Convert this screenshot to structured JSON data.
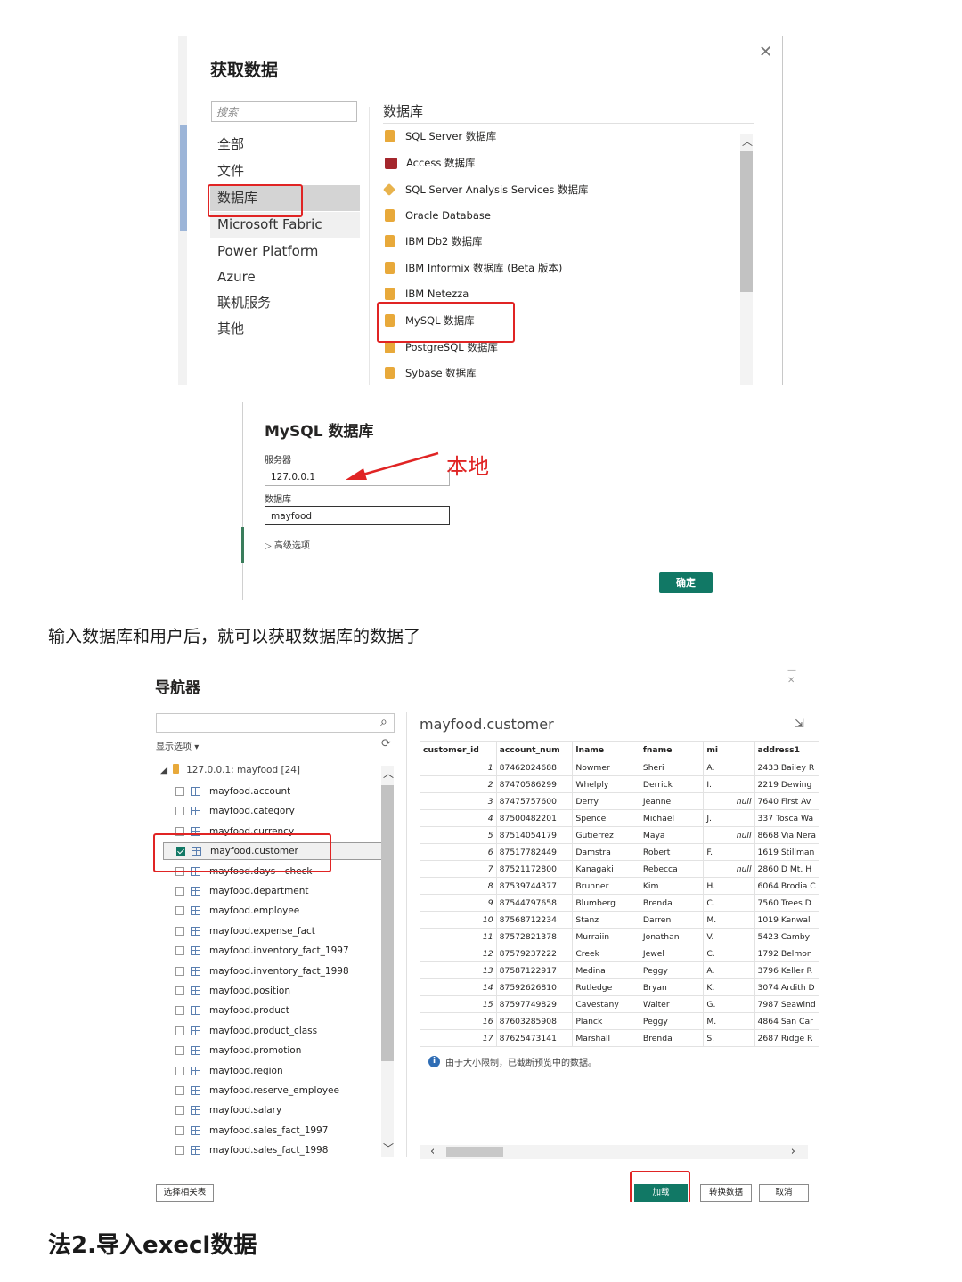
{
  "get_data": {
    "title": "获取数据",
    "search_placeholder": "搜索",
    "categories": [
      "全部",
      "文件",
      "数据库",
      "Microsoft Fabric",
      "Power Platform",
      "Azure",
      "联机服务",
      "其他"
    ],
    "section_title": "数据库",
    "connectors": [
      {
        "label": "SQL Server 数据库",
        "icon": "cylinder-icon"
      },
      {
        "label": "Access 数据库",
        "icon": "access-icon"
      },
      {
        "label": "SQL Server Analysis Services 数据库",
        "icon": "cube-icon"
      },
      {
        "label": "Oracle Database",
        "icon": "cylinder-icon"
      },
      {
        "label": "IBM Db2 数据库",
        "icon": "cylinder-icon"
      },
      {
        "label": "IBM Informix 数据库 (Beta 版本)",
        "icon": "cylinder-icon"
      },
      {
        "label": "IBM Netezza",
        "icon": "cylinder-icon"
      },
      {
        "label": "MySQL 数据库",
        "icon": "cylinder-icon"
      },
      {
        "label": "PostgreSQL 数据库",
        "icon": "cylinder-icon"
      },
      {
        "label": "Sybase 数据库",
        "icon": "cylinder-icon"
      }
    ]
  },
  "mysql": {
    "title": "MySQL 数据库",
    "server_label": "服务器",
    "server_value": "127.0.0.1",
    "database_label": "数据库",
    "database_value": "mayfood",
    "advanced": "高级选项",
    "ok": "确定",
    "annotation": "本地"
  },
  "caption": "输入数据库和用户后，就可以获取数据库的数据了",
  "navigator": {
    "title": "导航器",
    "display_options": "显示选项",
    "root": "127.0.0.1: mayfood [24]",
    "tables": [
      {
        "name": "mayfood.account",
        "checked": false
      },
      {
        "name": "mayfood.category",
        "checked": false
      },
      {
        "name": "mayfood.currency",
        "checked": false
      },
      {
        "name": "mayfood.customer",
        "checked": true
      },
      {
        "name": "mayfood.days - check",
        "checked": false
      },
      {
        "name": "mayfood.department",
        "checked": false
      },
      {
        "name": "mayfood.employee",
        "checked": false
      },
      {
        "name": "mayfood.expense_fact",
        "checked": false
      },
      {
        "name": "mayfood.inventory_fact_1997",
        "checked": false
      },
      {
        "name": "mayfood.inventory_fact_1998",
        "checked": false
      },
      {
        "name": "mayfood.position",
        "checked": false
      },
      {
        "name": "mayfood.product",
        "checked": false
      },
      {
        "name": "mayfood.product_class",
        "checked": false
      },
      {
        "name": "mayfood.promotion",
        "checked": false
      },
      {
        "name": "mayfood.region",
        "checked": false
      },
      {
        "name": "mayfood.reserve_employee",
        "checked": false
      },
      {
        "name": "mayfood.salary",
        "checked": false
      },
      {
        "name": "mayfood.sales_fact_1997",
        "checked": false
      },
      {
        "name": "mayfood.sales_fact_1998",
        "checked": false
      }
    ],
    "preview_title": "mayfood.customer",
    "columns": [
      "customer_id",
      "account_num",
      "lname",
      "fname",
      "mi",
      "address1"
    ],
    "rows": [
      [
        "1",
        "87462024688",
        "Nowmer",
        "Sheri",
        "A.",
        "2433 Bailey R"
      ],
      [
        "2",
        "87470586299",
        "Whelply",
        "Derrick",
        "I.",
        "2219 Dewing"
      ],
      [
        "3",
        "87475757600",
        "Derry",
        "Jeanne",
        "null",
        "7640 First Av"
      ],
      [
        "4",
        "87500482201",
        "Spence",
        "Michael",
        "J.",
        "337 Tosca Wa"
      ],
      [
        "5",
        "87514054179",
        "Gutierrez",
        "Maya",
        "null",
        "8668 Via Nera"
      ],
      [
        "6",
        "87517782449",
        "Damstra",
        "Robert",
        "F.",
        "1619 Stillman"
      ],
      [
        "7",
        "87521172800",
        "Kanagaki",
        "Rebecca",
        "null",
        "2860 D Mt. H"
      ],
      [
        "8",
        "87539744377",
        "Brunner",
        "Kim",
        "H.",
        "6064 Brodia C"
      ],
      [
        "9",
        "87544797658",
        "Blumberg",
        "Brenda",
        "C.",
        "7560 Trees D"
      ],
      [
        "10",
        "87568712234",
        "Stanz",
        "Darren",
        "M.",
        "1019 Kenwal"
      ],
      [
        "11",
        "87572821378",
        "Murraiin",
        "Jonathan",
        "V.",
        "5423 Camby"
      ],
      [
        "12",
        "87579237222",
        "Creek",
        "Jewel",
        "C.",
        "1792 Belmon"
      ],
      [
        "13",
        "87587122917",
        "Medina",
        "Peggy",
        "A.",
        "3796 Keller R"
      ],
      [
        "14",
        "87592626810",
        "Rutledge",
        "Bryan",
        "K.",
        "3074 Ardith D"
      ],
      [
        "15",
        "87597749829",
        "Cavestany",
        "Walter",
        "G.",
        "7987 Seawind"
      ],
      [
        "16",
        "87603285908",
        "Planck",
        "Peggy",
        "M.",
        "4864 San Car"
      ],
      [
        "17",
        "87625473141",
        "Marshall",
        "Brenda",
        "S.",
        "2687 Ridge R"
      ]
    ],
    "info": "由于大小限制，已截断预览中的数据。",
    "select_related": "选择相关表",
    "load": "加载",
    "transform": "转换数据",
    "cancel": "取消"
  },
  "heading": "法2.导入execl数据"
}
